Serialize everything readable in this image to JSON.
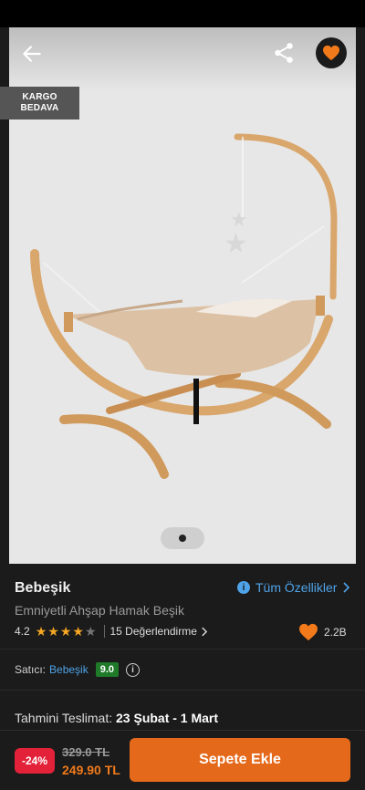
{
  "colors": {
    "accent": "#f27a1a",
    "cart_button": "#e5691b",
    "discount": "#e3223a",
    "link": "#4fa3e8",
    "seller_score": "#1f7a2a"
  },
  "gallery": {
    "badge_line1": "KARGO",
    "badge_line2": "BEDAVA",
    "icons": [
      "arrow-left-icon",
      "share-icon",
      "heart-icon"
    ]
  },
  "product": {
    "brand": "Bebeşik",
    "name": "Emniyetli Ahşap Hamak Beşik",
    "specs_link": "Tüm Özellikler",
    "rating": "4.2",
    "stars_filled": 4,
    "stars_total": 5,
    "reviews": "15 Değerlendirme",
    "favorites": "2.2B"
  },
  "seller": {
    "label": "Satıcı:",
    "name": "Bebeşik",
    "score": "9.0"
  },
  "delivery": {
    "label": "Tahmini Teslimat:",
    "date": "23 Şubat - 1 Mart"
  },
  "checkout": {
    "discount": "-24%",
    "old_price": "329.0 TL",
    "price": "249.90 TL",
    "add_to_cart": "Sepete Ekle"
  }
}
